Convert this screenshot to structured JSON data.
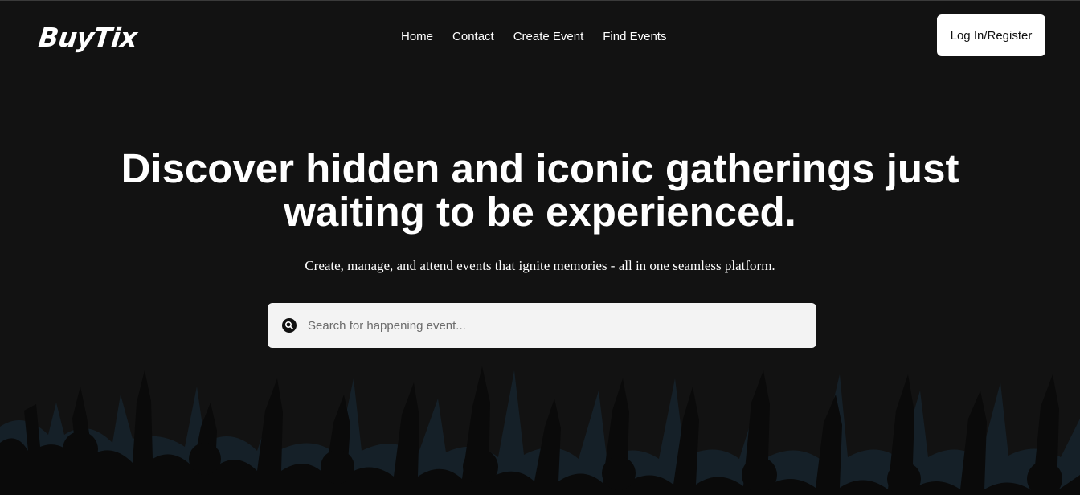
{
  "header": {
    "logo": "BuyTix",
    "nav": [
      {
        "label": "Home"
      },
      {
        "label": "Contact"
      },
      {
        "label": "Create Event"
      },
      {
        "label": "Find Events"
      }
    ],
    "login_label": "Log In/Register"
  },
  "hero": {
    "title": "Discover hidden and iconic gatherings just\nwaiting to be experienced.",
    "subtitle": "Create, manage, and attend events that ignite memories - all in one seamless platform.",
    "search": {
      "placeholder": "Search for happening event...",
      "value": "",
      "icon": "search-icon"
    }
  },
  "colors": {
    "background": "#121212",
    "crowd_silhouette": "#0a0a0a",
    "crowd_tint": "#16222b",
    "button_bg": "#ffffff",
    "search_bg": "#f3f3f3"
  }
}
